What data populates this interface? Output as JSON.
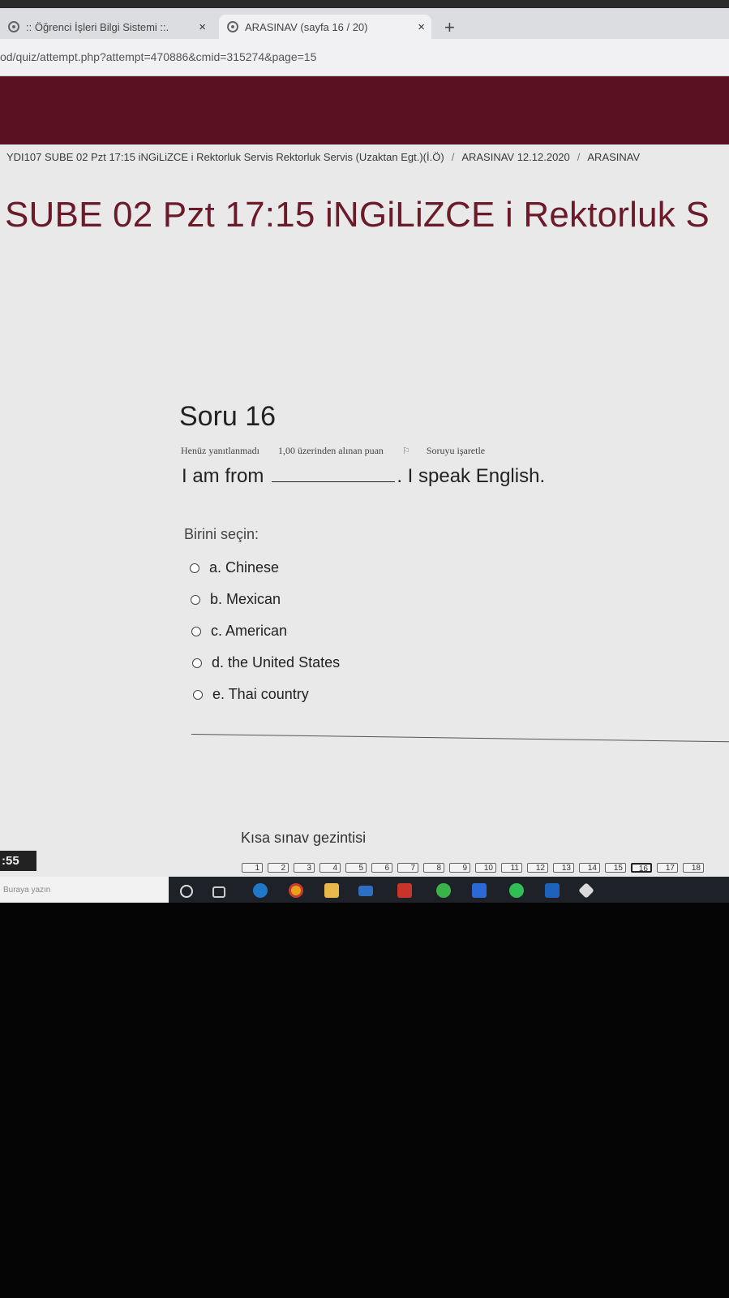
{
  "browser": {
    "tabs": [
      {
        "title": ":: Öğrenci İşleri Bilgi Sistemi ::.",
        "close": "×"
      },
      {
        "title": "ARASINAV (sayfa 16 / 20)",
        "close": "×"
      }
    ],
    "new_tab": "+",
    "url": "od/quiz/attempt.php?attempt=470886&cmid=315274&page=15"
  },
  "breadcrumb": [
    "YDI107 SUBE 02 Pzt 17:15 iNGiLiZCE i Rektorluk Servis Rektorluk Servis (Uzaktan Egt.)(İ.Ö)",
    "ARASINAV 12.12.2020",
    "ARASINAV"
  ],
  "breadcrumb_sep": "/",
  "page_title": "SUBE 02 Pzt 17:15 iNGiLiZCE i Rektorluk S",
  "question": {
    "number": "Soru 16",
    "status": "Henüz yanıtlanmadı",
    "grade": "1,00 üzerinden alınan puan",
    "flag": "Soruyu işaretle",
    "text_before": "I am from",
    "text_after": ". I speak English.",
    "prompt": "Birini seçin:",
    "options": [
      "a. Chinese",
      "b. Mexican",
      "c. American",
      "d. the United States",
      "e. Thai country"
    ]
  },
  "quiz_nav": {
    "title": "Kısa sınav gezintisi",
    "pages": [
      "1",
      "2",
      "3",
      "4",
      "5",
      "6",
      "7",
      "8",
      "9",
      "10",
      "11",
      "12",
      "13",
      "14",
      "15",
      "16",
      "17",
      "18"
    ],
    "current": "16"
  },
  "taskbar": {
    "clock": ":55",
    "search_placeholder": "Buraya yazın"
  },
  "colors": {
    "banner": "#5a1223",
    "title": "#6b1a2a"
  }
}
